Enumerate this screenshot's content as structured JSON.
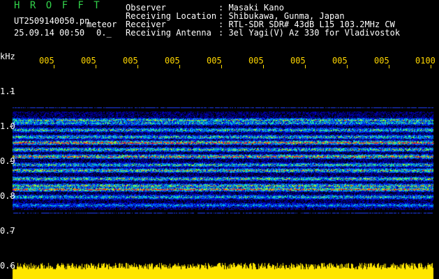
{
  "header": {
    "title": "H R O F F T",
    "file": "UT2509140050.pn",
    "tag": "meteor",
    "stamp": "25.09.14 00:50",
    "sec": "0._"
  },
  "info": {
    "fields": [
      {
        "label": "Observer",
        "value": ": Masaki Kano"
      },
      {
        "label": "Receiving Location",
        "value": ": Shibukawa, Gunma, Japan"
      },
      {
        "label": "Receiver",
        "value": ": RTL-SDR SDR# 43dB L15 103.2MHz CW"
      },
      {
        "label": "Receiving Antenna",
        "value": ": 3el Yagi(V) Az 330 for Vladivostok"
      }
    ]
  },
  "axis": {
    "unit": "kHz",
    "y_labels": [
      "1.1",
      "1.0",
      "0.9",
      "0.8",
      "0.7",
      "0.6"
    ],
    "time_ticks": [
      "005",
      "005",
      "005",
      "005",
      "005",
      "005",
      "005",
      "005",
      "005",
      "0100"
    ]
  },
  "colors": {
    "background": "#000000",
    "title": "#32d24a",
    "ticks": "#ffd700",
    "power": "#ffe600"
  }
}
